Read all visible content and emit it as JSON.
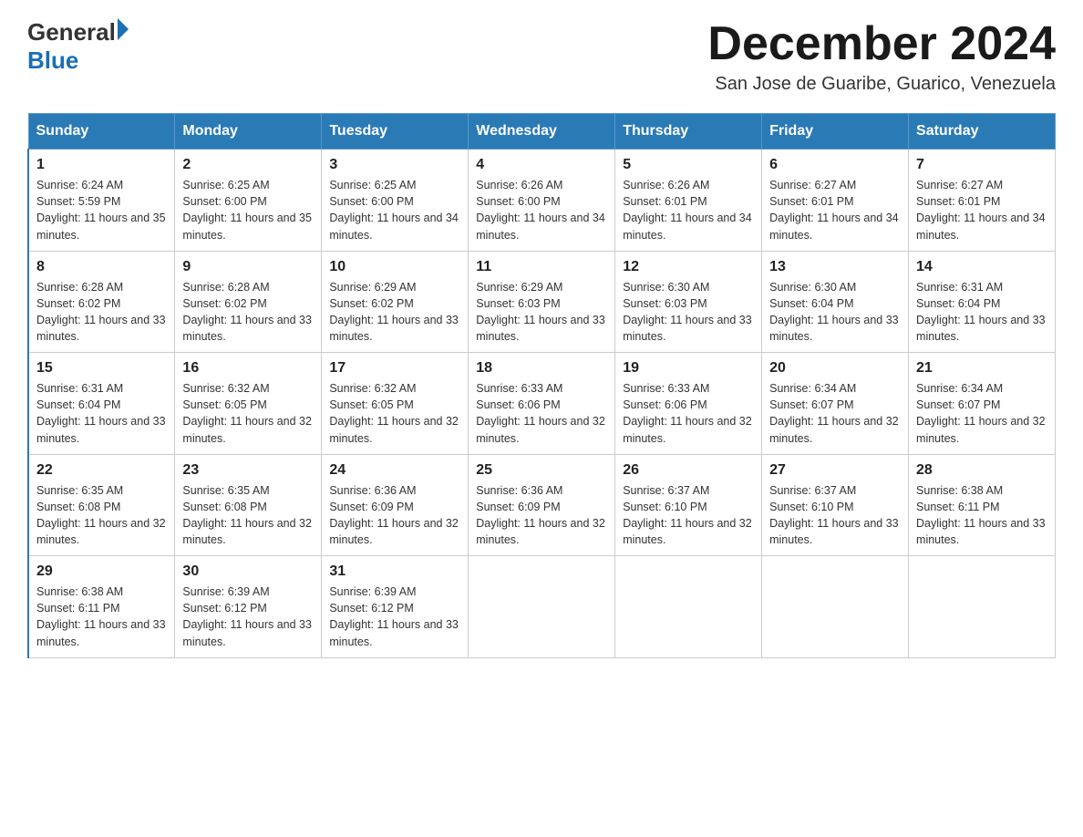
{
  "header": {
    "logo_general": "General",
    "logo_blue": "Blue",
    "month_title": "December 2024",
    "location": "San Jose de Guaribe, Guarico, Venezuela"
  },
  "weekdays": [
    "Sunday",
    "Monday",
    "Tuesday",
    "Wednesday",
    "Thursday",
    "Friday",
    "Saturday"
  ],
  "weeks": [
    [
      {
        "day": "1",
        "sunrise": "6:24 AM",
        "sunset": "5:59 PM",
        "daylight": "11 hours and 35 minutes."
      },
      {
        "day": "2",
        "sunrise": "6:25 AM",
        "sunset": "6:00 PM",
        "daylight": "11 hours and 35 minutes."
      },
      {
        "day": "3",
        "sunrise": "6:25 AM",
        "sunset": "6:00 PM",
        "daylight": "11 hours and 34 minutes."
      },
      {
        "day": "4",
        "sunrise": "6:26 AM",
        "sunset": "6:00 PM",
        "daylight": "11 hours and 34 minutes."
      },
      {
        "day": "5",
        "sunrise": "6:26 AM",
        "sunset": "6:01 PM",
        "daylight": "11 hours and 34 minutes."
      },
      {
        "day": "6",
        "sunrise": "6:27 AM",
        "sunset": "6:01 PM",
        "daylight": "11 hours and 34 minutes."
      },
      {
        "day": "7",
        "sunrise": "6:27 AM",
        "sunset": "6:01 PM",
        "daylight": "11 hours and 34 minutes."
      }
    ],
    [
      {
        "day": "8",
        "sunrise": "6:28 AM",
        "sunset": "6:02 PM",
        "daylight": "11 hours and 33 minutes."
      },
      {
        "day": "9",
        "sunrise": "6:28 AM",
        "sunset": "6:02 PM",
        "daylight": "11 hours and 33 minutes."
      },
      {
        "day": "10",
        "sunrise": "6:29 AM",
        "sunset": "6:02 PM",
        "daylight": "11 hours and 33 minutes."
      },
      {
        "day": "11",
        "sunrise": "6:29 AM",
        "sunset": "6:03 PM",
        "daylight": "11 hours and 33 minutes."
      },
      {
        "day": "12",
        "sunrise": "6:30 AM",
        "sunset": "6:03 PM",
        "daylight": "11 hours and 33 minutes."
      },
      {
        "day": "13",
        "sunrise": "6:30 AM",
        "sunset": "6:04 PM",
        "daylight": "11 hours and 33 minutes."
      },
      {
        "day": "14",
        "sunrise": "6:31 AM",
        "sunset": "6:04 PM",
        "daylight": "11 hours and 33 minutes."
      }
    ],
    [
      {
        "day": "15",
        "sunrise": "6:31 AM",
        "sunset": "6:04 PM",
        "daylight": "11 hours and 33 minutes."
      },
      {
        "day": "16",
        "sunrise": "6:32 AM",
        "sunset": "6:05 PM",
        "daylight": "11 hours and 32 minutes."
      },
      {
        "day": "17",
        "sunrise": "6:32 AM",
        "sunset": "6:05 PM",
        "daylight": "11 hours and 32 minutes."
      },
      {
        "day": "18",
        "sunrise": "6:33 AM",
        "sunset": "6:06 PM",
        "daylight": "11 hours and 32 minutes."
      },
      {
        "day": "19",
        "sunrise": "6:33 AM",
        "sunset": "6:06 PM",
        "daylight": "11 hours and 32 minutes."
      },
      {
        "day": "20",
        "sunrise": "6:34 AM",
        "sunset": "6:07 PM",
        "daylight": "11 hours and 32 minutes."
      },
      {
        "day": "21",
        "sunrise": "6:34 AM",
        "sunset": "6:07 PM",
        "daylight": "11 hours and 32 minutes."
      }
    ],
    [
      {
        "day": "22",
        "sunrise": "6:35 AM",
        "sunset": "6:08 PM",
        "daylight": "11 hours and 32 minutes."
      },
      {
        "day": "23",
        "sunrise": "6:35 AM",
        "sunset": "6:08 PM",
        "daylight": "11 hours and 32 minutes."
      },
      {
        "day": "24",
        "sunrise": "6:36 AM",
        "sunset": "6:09 PM",
        "daylight": "11 hours and 32 minutes."
      },
      {
        "day": "25",
        "sunrise": "6:36 AM",
        "sunset": "6:09 PM",
        "daylight": "11 hours and 32 minutes."
      },
      {
        "day": "26",
        "sunrise": "6:37 AM",
        "sunset": "6:10 PM",
        "daylight": "11 hours and 32 minutes."
      },
      {
        "day": "27",
        "sunrise": "6:37 AM",
        "sunset": "6:10 PM",
        "daylight": "11 hours and 33 minutes."
      },
      {
        "day": "28",
        "sunrise": "6:38 AM",
        "sunset": "6:11 PM",
        "daylight": "11 hours and 33 minutes."
      }
    ],
    [
      {
        "day": "29",
        "sunrise": "6:38 AM",
        "sunset": "6:11 PM",
        "daylight": "11 hours and 33 minutes."
      },
      {
        "day": "30",
        "sunrise": "6:39 AM",
        "sunset": "6:12 PM",
        "daylight": "11 hours and 33 minutes."
      },
      {
        "day": "31",
        "sunrise": "6:39 AM",
        "sunset": "6:12 PM",
        "daylight": "11 hours and 33 minutes."
      },
      null,
      null,
      null,
      null
    ]
  ]
}
